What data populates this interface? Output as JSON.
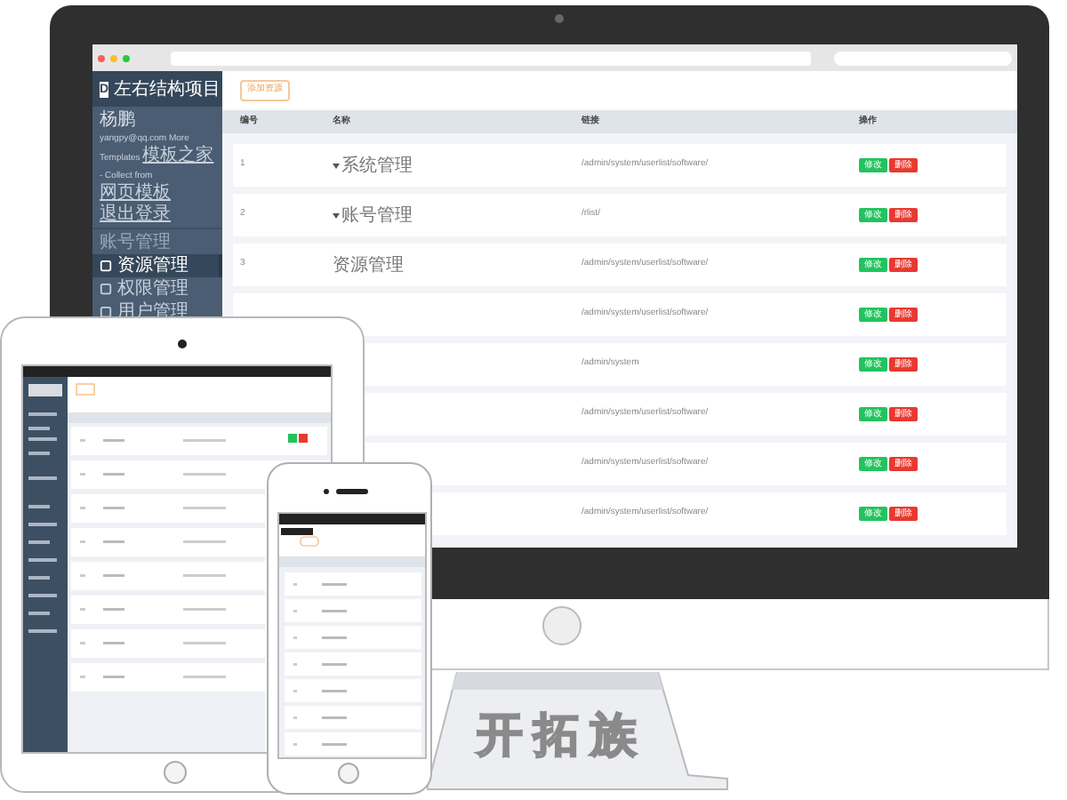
{
  "sidebar": {
    "logo_letter": "D",
    "title": "左右结构项目",
    "user_name": "杨鹏",
    "user_info": {
      "before": "yangpy@qq.com More Templates ",
      "link1": "模板之家",
      "middle": " - Collect from ",
      "link2": "网页模板"
    },
    "logout": "退出登录",
    "section": "账号管理",
    "menu": [
      {
        "label": "资源管理",
        "selected": true
      },
      {
        "label": "权限管理",
        "selected": false
      },
      {
        "label": "用户管理",
        "selected": false
      }
    ]
  },
  "content": {
    "add_button": "添加资源",
    "columns": [
      "编号",
      "名称",
      "链接",
      "操作"
    ],
    "rows": [
      {
        "number": "1",
        "name": "系统管理",
        "expandable": true,
        "link": "/admin/system/userlist/software/",
        "actions": [
          "修改",
          "删除"
        ]
      },
      {
        "number": "2",
        "name": "账号管理",
        "expandable": true,
        "link": "/rlist/",
        "actions": [
          "修改",
          "删除"
        ]
      },
      {
        "number": "3",
        "name": "资源管理",
        "expandable": false,
        "link": "/admin/system/userlist/software/",
        "actions": [
          "修改",
          "删除"
        ]
      },
      {
        "link": "/admin/system/userlist/software/",
        "actions": [
          "修改",
          "删除"
        ]
      },
      {
        "link": "/admin/system",
        "actions": [
          "修改",
          "删除"
        ]
      },
      {
        "link": "/admin/system/userlist/software/",
        "actions": [
          "修改",
          "删除"
        ]
      },
      {
        "link": "/admin/system/userlist/software/",
        "actions": [
          "修改",
          "删除"
        ]
      },
      {
        "link": "/admin/system/userlist/software/",
        "actions": [
          "修改",
          "删除"
        ]
      }
    ]
  },
  "stand_logo": "开拓族"
}
